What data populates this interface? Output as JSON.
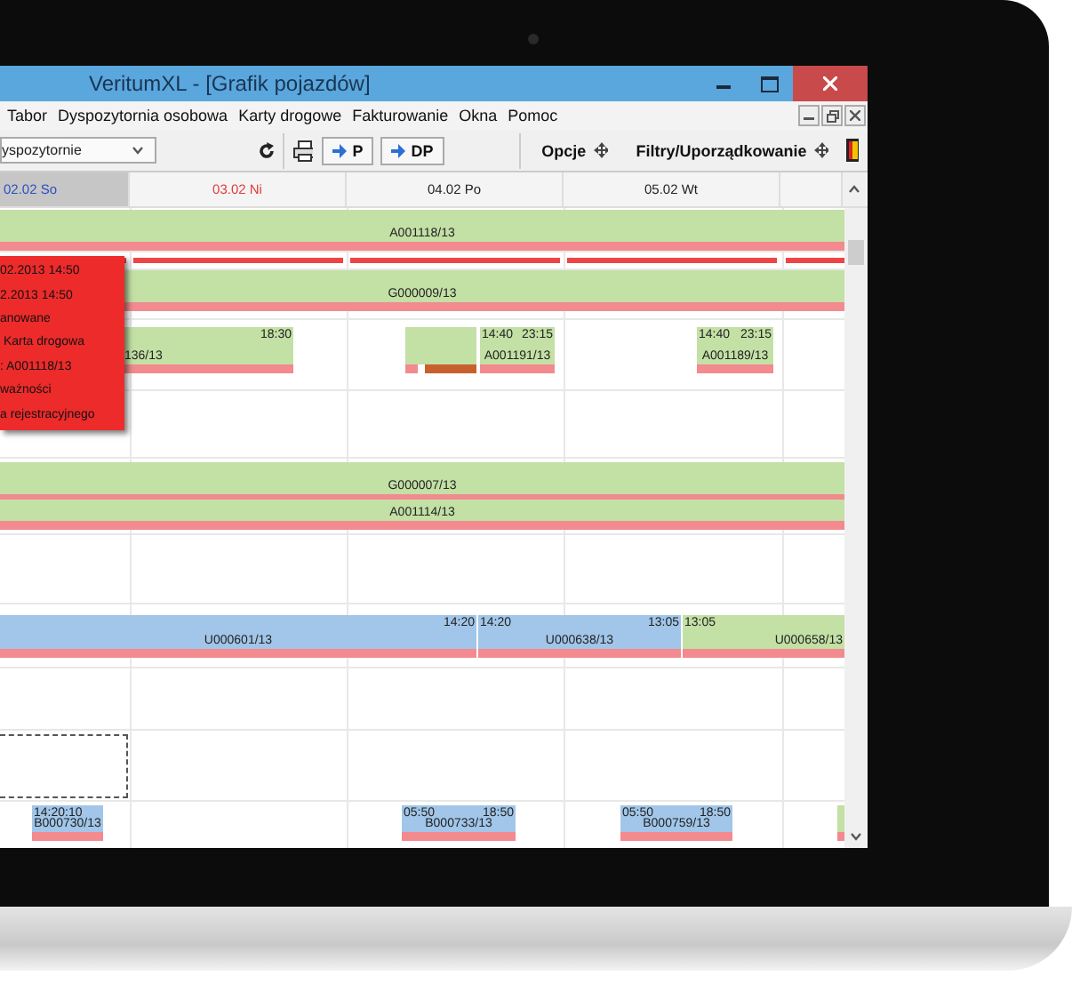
{
  "window": {
    "title": "VeritumXL - [Grafik pojazdów]"
  },
  "menu": [
    "Tabor",
    "Dyspozytornia osobowa",
    "Karty drogowe",
    "Fakturowanie",
    "Okna",
    "Pomoc"
  ],
  "toolbar": {
    "dropdown": "yspozytornie",
    "buttons": [
      "P",
      "DP"
    ],
    "options": "Opcje",
    "filters": "Filtry/Uporządkowanie"
  },
  "days": [
    {
      "label": "02.02 So",
      "kind": "saturday",
      "selected": true
    },
    {
      "label": "03.02 Ni",
      "kind": "sunday",
      "selected": false
    },
    {
      "label": "04.02 Po",
      "kind": "weekday",
      "selected": false
    },
    {
      "label": "05.02 Wt",
      "kind": "weekday",
      "selected": false
    }
  ],
  "rows": [
    {
      "bars": [
        {
          "label": "A001118/13",
          "color": "#c3e0a5"
        }
      ]
    },
    {
      "bars": [
        {
          "label": "G000009/13",
          "color": "#c3e0a5"
        }
      ]
    },
    {
      "bars": [
        {
          "label": "136/13",
          "end": "18:30",
          "color": "#c3e0a5"
        },
        {
          "color": "#c3e0a5",
          "warning": true
        },
        {
          "label": "A001191/13",
          "start": "14:40",
          "end": "23:15",
          "color": "#c3e0a5"
        },
        {
          "label": "A001189/13",
          "start": "14:40",
          "end": "23:15",
          "color": "#c3e0a5"
        }
      ]
    },
    {
      "bars": [
        {
          "label": "G000007/13",
          "color": "#c3e0a5"
        },
        {
          "label": "A001114/13",
          "color": "#c3e0a5"
        }
      ]
    },
    {
      "bars": [
        {
          "label": "U000601/13",
          "end": "14:20",
          "color": "#a1c6e9"
        },
        {
          "label": "U000638/13",
          "start": "14:20",
          "end": "13:05",
          "color": "#a1c6e9"
        },
        {
          "label": "U000658/13",
          "start": "13:05",
          "color": "#c3e0a5"
        }
      ]
    },
    {
      "bars": [
        {
          "label": "B000730/13",
          "start": "14:20:10",
          "color": "#a1c6e9"
        },
        {
          "label": "B000733/13",
          "start": "05:50",
          "end": "18:50",
          "color": "#a1c6e9"
        },
        {
          "label": "B000759/13",
          "start": "05:50",
          "end": "18:50",
          "color": "#a1c6e9"
        },
        {
          "color": "#c3e0a5"
        }
      ]
    }
  ],
  "tooltip": {
    "lines": [
      "02.2013 14:50",
      "2.2013 14:50",
      "anowane",
      " Karta drogowa",
      ": A001118/13",
      "ważności",
      "a rejestracyjnego"
    ]
  }
}
